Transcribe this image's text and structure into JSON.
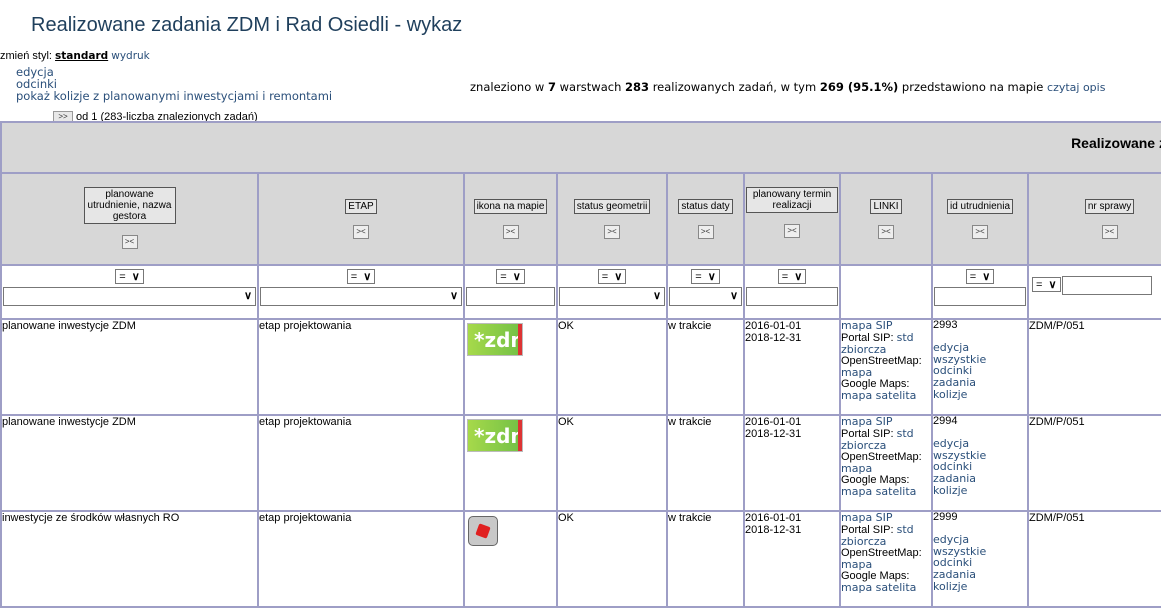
{
  "title": "Realizowane zadania ZDM i Rad Osiedli - wykaz",
  "style_switch": {
    "prefix": "zmień styl:",
    "standard": "standard",
    "print": "wydruk"
  },
  "left_links": [
    "edycja",
    "odcinki",
    "pokaż kolizje z planowanymi inwestycjami i remontami"
  ],
  "summary": {
    "p1": "znaleziono w ",
    "layers": "7",
    "p2": " warstwach ",
    "total": "283",
    "p3": " realizowanych zadań, w tym ",
    "shown": "269",
    "pct": " (95.1%)",
    "p4": " przedstawiono na mapie ",
    "link": "czytaj opis"
  },
  "pager": {
    "nav": ">>",
    "text": "od 1  (283-liczba znalezionych zadań)"
  },
  "band_title": "Realizowane zada",
  "columns": [
    {
      "label": "planowane utrudnienie, nazwa gestora"
    },
    {
      "label": "ETAP"
    },
    {
      "label": "ikona na mapie"
    },
    {
      "label": "status geometrii"
    },
    {
      "label": "status daty"
    },
    {
      "label": "planowany termin realizacji"
    },
    {
      "label": "LINKI"
    },
    {
      "label": "id utrudnienia"
    },
    {
      "label": "nr sprawy"
    }
  ],
  "sort_glyph": "><",
  "filter_op": "=",
  "rows": [
    {
      "gestor": "planowane inwestycje ZDM",
      "etap": "etap projektowania",
      "icon": "zdm-logo-icon",
      "geom": "OK",
      "date_status": "w trakcie",
      "from": "2016-01-01",
      "to": "2018-12-31",
      "id": "2993",
      "case": "ZDM/P/051"
    },
    {
      "gestor": "planowane inwestycje ZDM",
      "etap": "etap projektowania",
      "icon": "zdm-logo-icon",
      "geom": "OK",
      "date_status": "w trakcie",
      "from": "2016-01-01",
      "to": "2018-12-31",
      "id": "2994",
      "case": "ZDM/P/051"
    },
    {
      "gestor": "inwestycje ze środków własnych RO",
      "etap": "etap projektowania",
      "icon": "ro-cube-icon",
      "geom": "OK",
      "date_status": "w trakcie",
      "from": "2016-01-01",
      "to": "2018-12-31",
      "id": "2999",
      "case": "ZDM/P/051"
    }
  ],
  "links_cell": {
    "mapa_sip": "mapa SIP",
    "portal_sip": "Portal SIP:",
    "std": "std",
    "zbiorcza": "zbiorcza",
    "osm": "OpenStreetMap:",
    "mapa": "mapa",
    "google": "Google Maps:",
    "satelita": "mapa satelita"
  },
  "id_links": [
    "edycja",
    "wszystkie odcinki",
    "zadania",
    "kolizje"
  ],
  "colors": {
    "header_bg": "#d7d7d7",
    "border": "#9e9ec6",
    "link": "#2a4f7a",
    "title": "#1f3f5c"
  }
}
